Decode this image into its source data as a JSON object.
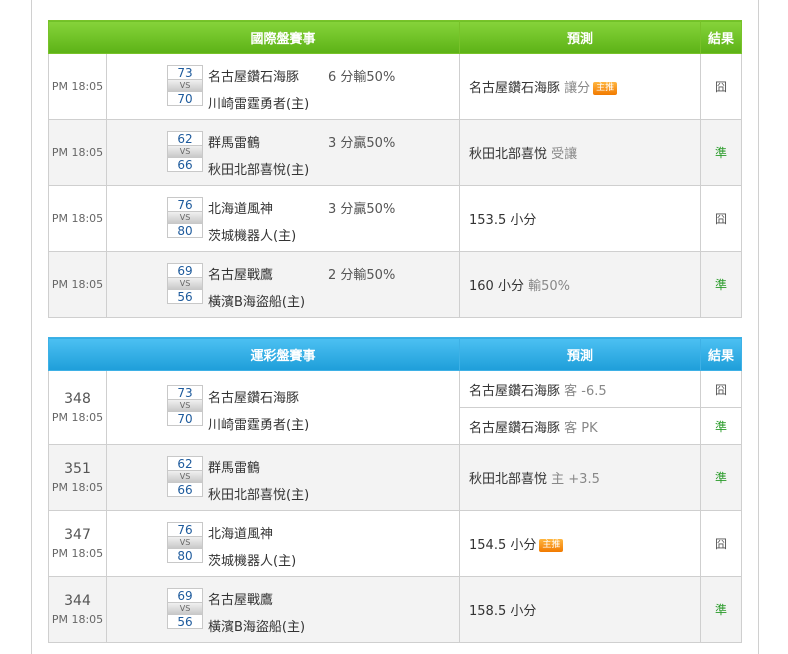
{
  "international": {
    "header": {
      "event": "國際盤賽事",
      "prediction": "預測",
      "result": "結果"
    },
    "rows": [
      {
        "time": "PM 18:05",
        "score_a": "73",
        "score_b": "70",
        "vs": "VS",
        "team_a": "名古屋鑽石海豚",
        "team_b": "川崎雷霆勇者(主)",
        "handicap": "6 分輸50%",
        "pred_main": "名古屋鑽石海豚",
        "pred_sub": " 讓分",
        "badge": "主推",
        "result": "囧"
      },
      {
        "time": "PM 18:05",
        "score_a": "62",
        "score_b": "66",
        "vs": "VS",
        "team_a": "群馬雷鶴",
        "team_b": "秋田北部喜悅(主)",
        "handicap": "3 分贏50%",
        "pred_main": "秋田北部喜悅",
        "pred_sub": " 受讓",
        "badge": "",
        "result": "準"
      },
      {
        "time": "PM 18:05",
        "score_a": "76",
        "score_b": "80",
        "vs": "VS",
        "team_a": "北海道風神",
        "team_b": "茨城機器人(主)",
        "handicap": "3 分贏50%",
        "pred_main": "153.5 小分",
        "pred_sub": "",
        "badge": "",
        "result": "囧"
      },
      {
        "time": "PM 18:05",
        "score_a": "69",
        "score_b": "56",
        "vs": "VS",
        "team_a": "名古屋戰鷹",
        "team_b": "橫濱B海盜船(主)",
        "handicap": "2 分輸50%",
        "pred_main": "160 小分",
        "pred_sub": " 輸50%",
        "badge": "",
        "result": "準"
      }
    ]
  },
  "lottery": {
    "header": {
      "event": "運彩盤賽事",
      "prediction": "預測",
      "result": "結果"
    },
    "rows": [
      {
        "num": "348",
        "time": "PM 18:05",
        "score_a": "73",
        "score_b": "70",
        "vs": "VS",
        "team_a": "名古屋鑽石海豚",
        "team_b": "川崎雷霆勇者(主)",
        "preds": [
          {
            "main": "名古屋鑽石海豚",
            "sub": " 客 -6.5",
            "result": "囧"
          },
          {
            "main": "名古屋鑽石海豚",
            "sub": " 客 PK",
            "result": "準"
          }
        ]
      },
      {
        "num": "351",
        "time": "PM 18:05",
        "score_a": "62",
        "score_b": "66",
        "vs": "VS",
        "team_a": "群馬雷鶴",
        "team_b": "秋田北部喜悅(主)",
        "preds": [
          {
            "main": "秋田北部喜悅",
            "sub": " 主 +3.5",
            "result": "準"
          }
        ]
      },
      {
        "num": "347",
        "time": "PM 18:05",
        "score_a": "76",
        "score_b": "80",
        "vs": "VS",
        "team_a": "北海道風神",
        "team_b": "茨城機器人(主)",
        "preds": [
          {
            "main": "154.5 小分",
            "sub": "",
            "badge": "主推",
            "result": "囧"
          }
        ]
      },
      {
        "num": "344",
        "time": "PM 18:05",
        "score_a": "69",
        "score_b": "56",
        "vs": "VS",
        "team_a": "名古屋戰鷹",
        "team_b": "橫濱B海盜船(主)",
        "preds": [
          {
            "main": "158.5 小分",
            "sub": "",
            "result": "準"
          }
        ]
      }
    ]
  },
  "colors": {
    "win": "#2a9b2a",
    "lose": "#555555",
    "header_green": "#5cb216",
    "header_blue": "#1e9ed9",
    "badge": "#f27a00"
  }
}
